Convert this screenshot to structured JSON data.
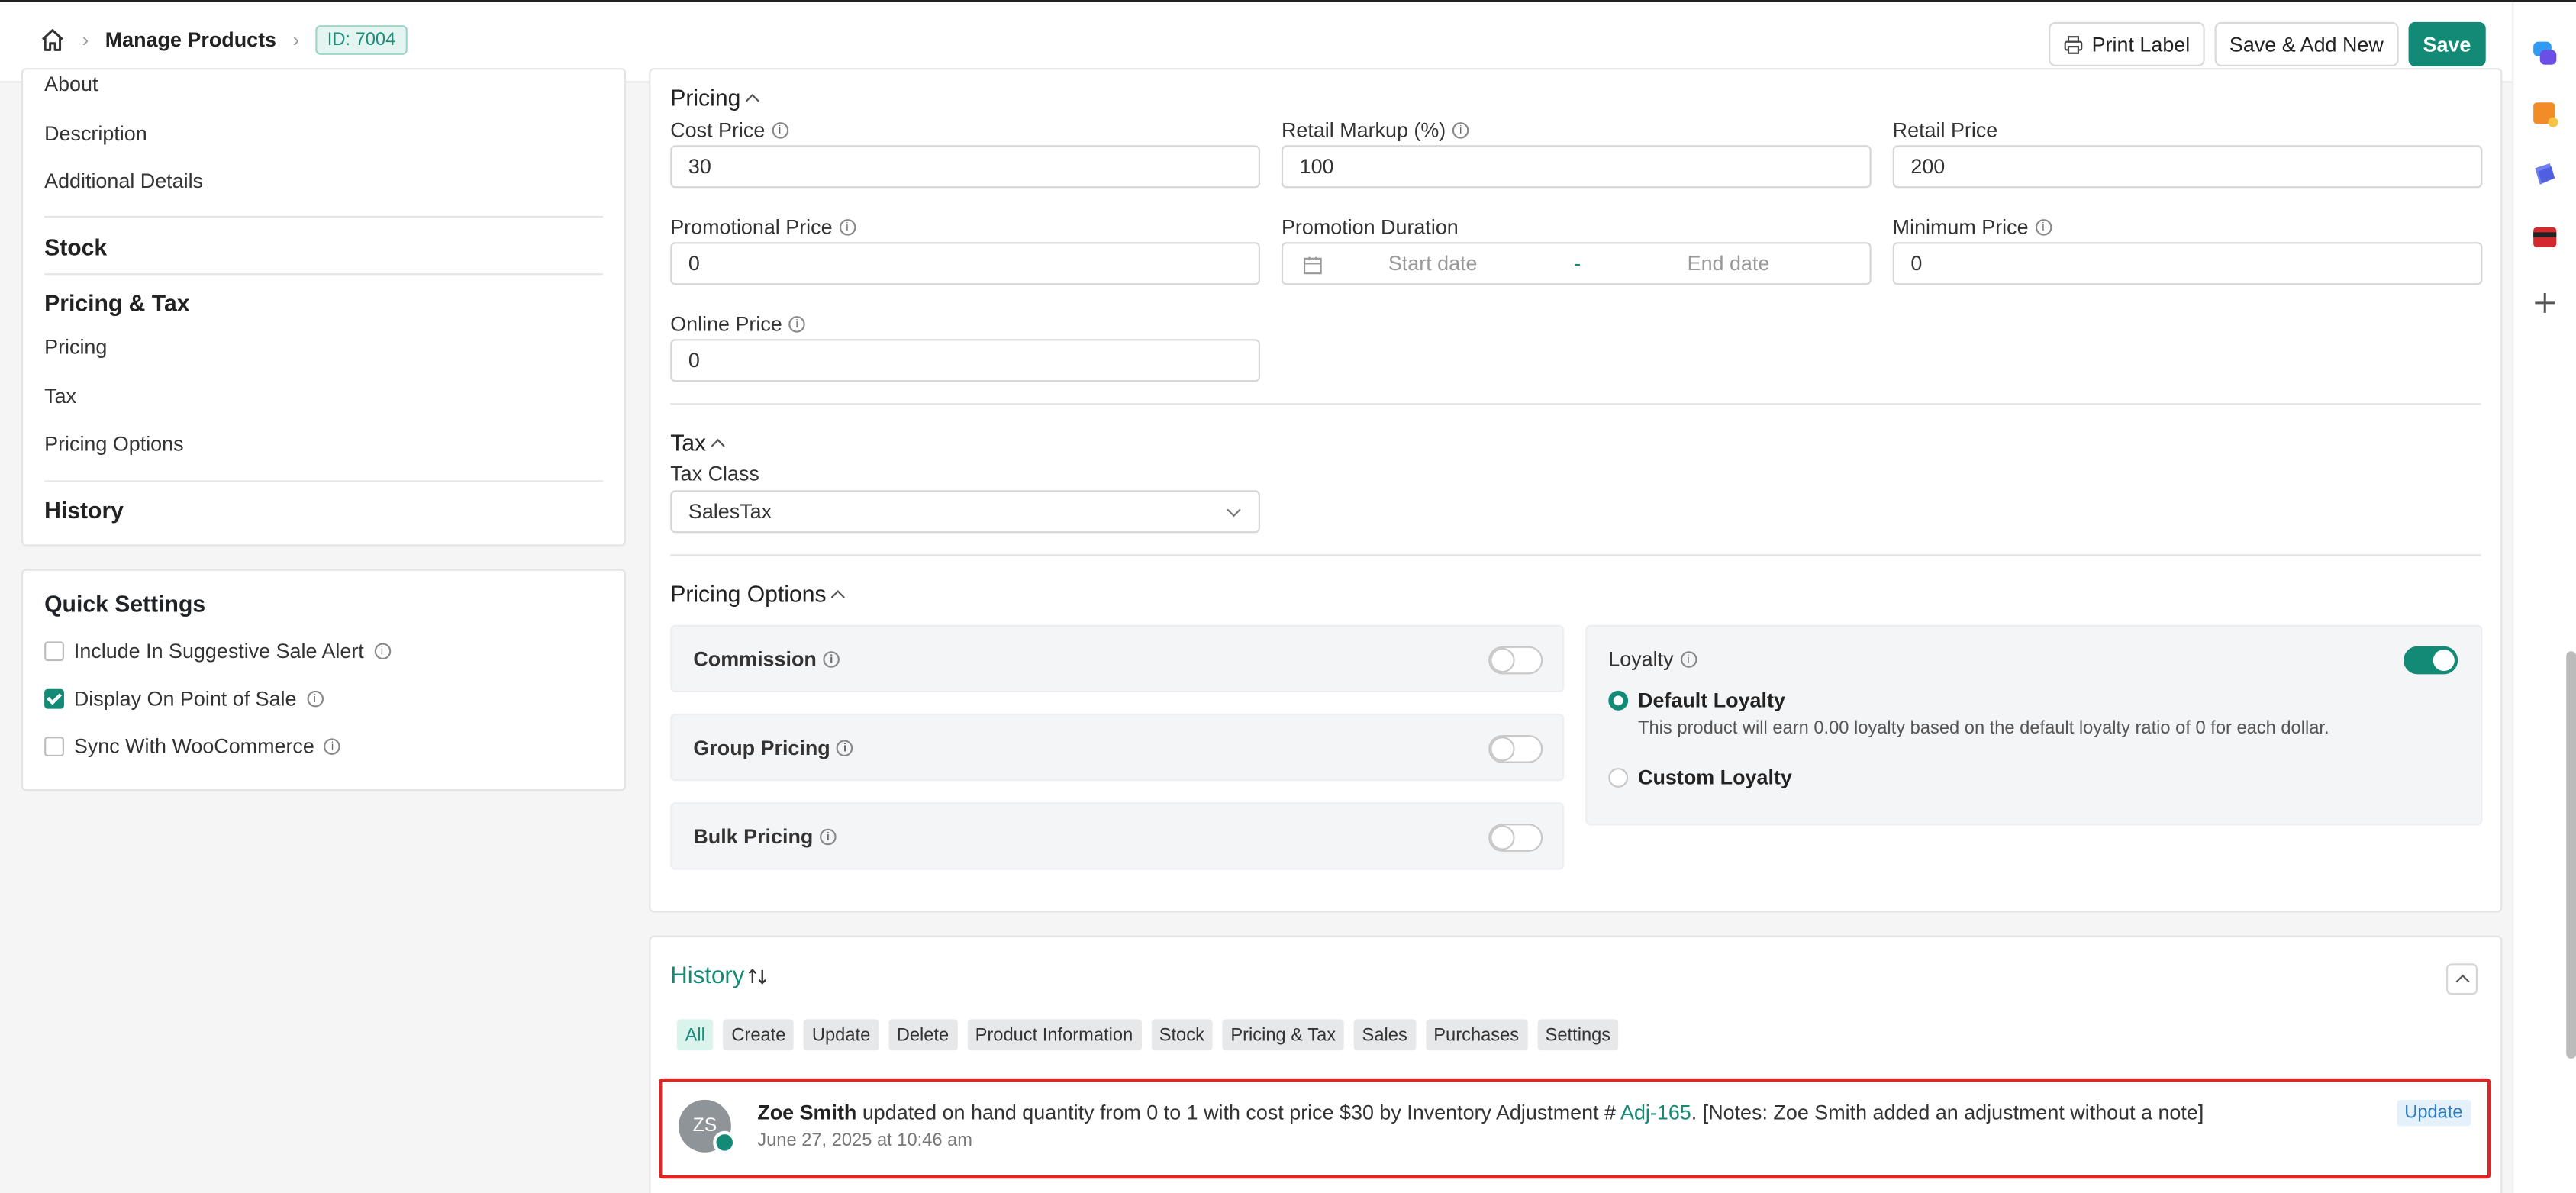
{
  "header": {
    "breadcrumb_title": "Manage Products",
    "id_badge": "ID: 7004",
    "actions": {
      "print_label": "Print Label",
      "save_add_new": "Save & Add New",
      "save": "Save"
    }
  },
  "left_nav": {
    "items_top": [
      "About",
      "Description",
      "Additional Details"
    ],
    "stock": "Stock",
    "pricing_tax": "Pricing & Tax",
    "pricing_tax_items": [
      "Pricing",
      "Tax",
      "Pricing Options"
    ],
    "history": "History"
  },
  "quick_settings": {
    "title": "Quick Settings",
    "items": [
      {
        "label": "Include In Suggestive Sale Alert",
        "checked": false
      },
      {
        "label": "Display On Point of Sale",
        "checked": true
      },
      {
        "label": "Sync With WooCommerce",
        "checked": false
      }
    ]
  },
  "pricing": {
    "section_title": "Pricing",
    "cost_price": {
      "label": "Cost Price",
      "value": "30"
    },
    "retail_markup": {
      "label": "Retail Markup (%)",
      "value": "100"
    },
    "retail_price": {
      "label": "Retail Price",
      "value": "200"
    },
    "promotional_price": {
      "label": "Promotional Price",
      "value": "0"
    },
    "promotion_duration": {
      "label": "Promotion Duration",
      "start_placeholder": "Start date",
      "separator": "-",
      "end_placeholder": "End date"
    },
    "minimum_price": {
      "label": "Minimum Price",
      "value": "0"
    },
    "online_price": {
      "label": "Online Price",
      "value": "0"
    }
  },
  "tax": {
    "section_title": "Tax",
    "tax_class_label": "Tax Class",
    "tax_class_value": "SalesTax"
  },
  "pricing_options": {
    "section_title": "Pricing Options",
    "commission": {
      "label": "Commission",
      "enabled": false
    },
    "group_pricing": {
      "label": "Group Pricing",
      "enabled": false
    },
    "bulk_pricing": {
      "label": "Bulk Pricing",
      "enabled": false
    },
    "loyalty": {
      "label": "Loyalty",
      "enabled": true,
      "default_label": "Default Loyalty",
      "default_desc": "This product will earn 0.00 loyalty based on the default loyalty ratio of 0 for each dollar.",
      "custom_label": "Custom Loyalty",
      "selected": "default"
    }
  },
  "history": {
    "title": "History",
    "filters": [
      "All",
      "Create",
      "Update",
      "Delete",
      "Product Information",
      "Stock",
      "Pricing & Tax",
      "Sales",
      "Purchases",
      "Settings"
    ],
    "active_filter": "All",
    "entries": [
      {
        "initials": "ZS",
        "user": "Zoe Smith",
        "text_before": " updated on hand quantity from 0 to 1 with cost price $30 by Inventory Adjustment # ",
        "link": "Adj-165",
        "text_after": ". [Notes: Zoe Smith added an adjustment without a note]",
        "date": "June 27, 2025 at 10:46 am",
        "badge": "Update"
      }
    ]
  },
  "colors": {
    "accent": "#138a76",
    "highlight_border": "#e02525"
  }
}
